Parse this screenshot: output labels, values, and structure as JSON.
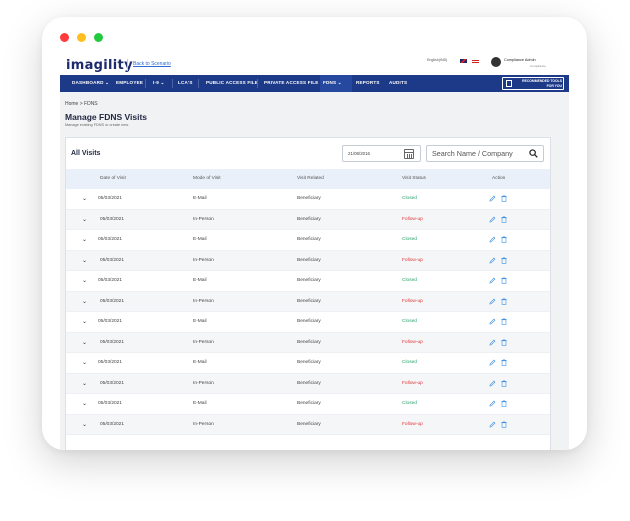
{
  "window": {
    "controls": [
      "close",
      "minimize",
      "maximize"
    ]
  },
  "topbar": {
    "logo": "imagility",
    "back_link": "Back to Scenario",
    "language": "English(IND)",
    "user_name": "Compliance Admin",
    "user_role": "Compliance"
  },
  "nav": {
    "items": [
      {
        "label": "DASHBOARD",
        "has_caret": true
      },
      {
        "label": "EMPLOYEE",
        "has_caret": false
      },
      {
        "label": "I-9",
        "has_caret": true
      },
      {
        "label": "LCA'S",
        "has_caret": false
      },
      {
        "label": "PUBLIC ACCESS FILE",
        "has_caret": false
      },
      {
        "label": "PRIVATE ACCESS FILE",
        "has_caret": false
      },
      {
        "label": "FDNS",
        "has_caret": true
      },
      {
        "label": "REPORTS",
        "has_caret": false
      },
      {
        "label": "AUDITS",
        "has_caret": false
      }
    ],
    "rec_tools": "RECOMMENDED TOOLS FOR YOU",
    "active": "FDNS"
  },
  "breadcrumb": "Home > FDNS",
  "page": {
    "title": "Manage FDNS Visits",
    "subtitle": "Manage existing FDNS or create new."
  },
  "card": {
    "title": "All Visits",
    "date_value": "21/08/2016",
    "search_placeholder": "Search Name / Company"
  },
  "table": {
    "headers": [
      "Date of Visit",
      "Mode of Visit",
      "Visit Related",
      "Visit Status",
      "Action"
    ],
    "rows": [
      {
        "date": "05/03/2021",
        "mode": "E-Mail",
        "related": "Beneficiary",
        "status": "Closed"
      },
      {
        "date": "05/03/2021",
        "mode": "In-Person",
        "related": "Beneficiary",
        "status": "Follow-up"
      },
      {
        "date": "05/03/2021",
        "mode": "E-Mail",
        "related": "Beneficiary",
        "status": "Closed"
      },
      {
        "date": "05/03/2021",
        "mode": "In-Person",
        "related": "Beneficiary",
        "status": "Follow-up"
      },
      {
        "date": "05/03/2021",
        "mode": "E-Mail",
        "related": "Beneficiary",
        "status": "Closed"
      },
      {
        "date": "05/03/2021",
        "mode": "In-Person",
        "related": "Beneficiary",
        "status": "Follow-up"
      },
      {
        "date": "05/03/2021",
        "mode": "E-Mail",
        "related": "Beneficiary",
        "status": "Closed"
      },
      {
        "date": "05/03/2021",
        "mode": "In-Person",
        "related": "Beneficiary",
        "status": "Follow-up"
      },
      {
        "date": "05/03/2021",
        "mode": "E-Mail",
        "related": "Beneficiary",
        "status": "Closed"
      },
      {
        "date": "05/03/2021",
        "mode": "In-Person",
        "related": "Beneficiary",
        "status": "Follow-up"
      },
      {
        "date": "05/03/2021",
        "mode": "E-Mail",
        "related": "Beneficiary",
        "status": "Closed"
      },
      {
        "date": "05/03/2021",
        "mode": "In-Person",
        "related": "Beneficiary",
        "status": "Follow-up"
      }
    ]
  },
  "icons": {
    "row_expand": "chevron-down-icon",
    "edit": "pencil-icon",
    "delete": "trash-icon",
    "calendar": "calendar-icon",
    "search": "search-icon"
  },
  "colors": {
    "nav_bg": "#1d3a88",
    "closed": "#2aa56a",
    "follow_up": "#e0343a",
    "action_icon": "#3a8de0",
    "header_bg": "#e9f0fa"
  }
}
